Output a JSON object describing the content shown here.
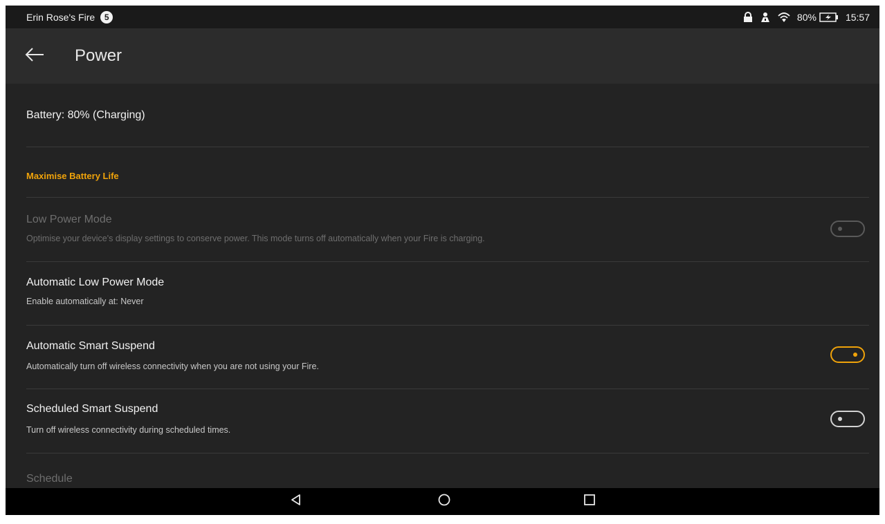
{
  "status_bar": {
    "device_name": "Erin Rose's Fire",
    "notification_badge": "5",
    "battery_percent": "80%",
    "time": "15:57",
    "icons": [
      "lock-icon",
      "person-icon",
      "wifi-icon",
      "battery-charging-icon"
    ]
  },
  "app_bar": {
    "back_icon": "arrow-left-icon",
    "title": "Power"
  },
  "battery_row": {
    "label": "Battery: 80% (Charging)"
  },
  "section": {
    "header": "Maximise Battery Life"
  },
  "settings": [
    {
      "title": "Low Power Mode",
      "subtitle": "Optimise your device's display settings to conserve power. This mode turns off automatically when your Fire is charging.",
      "toggle": "off",
      "enabled": false
    },
    {
      "title": "Automatic Low Power Mode",
      "subtitle": "Enable automatically at: Never"
    },
    {
      "title": "Automatic Smart Suspend",
      "subtitle": "Automatically turn off wireless connectivity when you are not using your Fire.",
      "toggle": "on",
      "enabled": true
    },
    {
      "title": "Scheduled Smart Suspend",
      "subtitle": "Turn off wireless connectivity during scheduled times.",
      "toggle": "off",
      "enabled": true
    }
  ],
  "schedule": {
    "label": "Schedule",
    "enabled": false
  },
  "nav_bar": {
    "icons": [
      "back-triangle-icon",
      "home-circle-icon",
      "recents-square-icon"
    ]
  },
  "colors": {
    "accent": "#f0a30a",
    "background": "#232323",
    "app_bar": "#2c2c2c",
    "status_bar": "#1a1a1a",
    "nav_bar": "#000000"
  }
}
